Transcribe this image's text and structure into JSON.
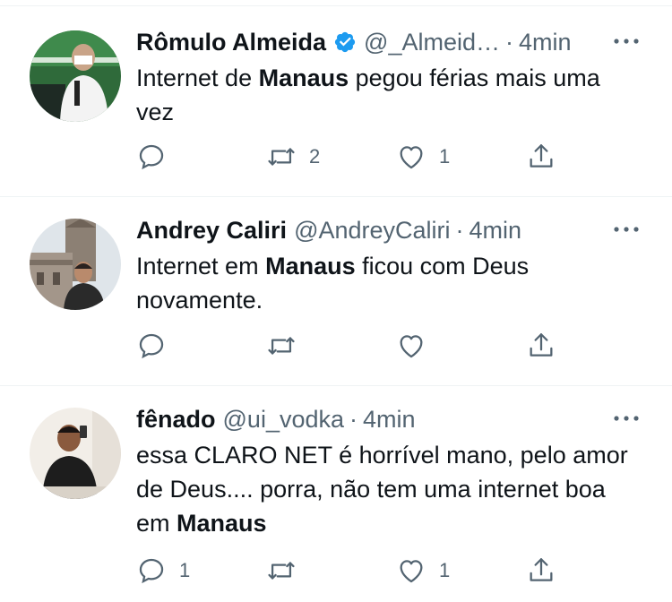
{
  "tweets": [
    {
      "name": "Rômulo Almeida",
      "verified": true,
      "handle": "@_Almeid…",
      "time": "4min",
      "text_before": "Internet de ",
      "text_bold": "Manaus",
      "text_after": " pegou férias mais uma vez",
      "replies": "",
      "retweets": "2",
      "likes": "1"
    },
    {
      "name": "Andrey Caliri",
      "verified": false,
      "handle": "@AndreyCaliri",
      "time": "4min",
      "text_before": "Internet em ",
      "text_bold": "Manaus",
      "text_after": " ficou com Deus novamente.",
      "replies": "",
      "retweets": "",
      "likes": ""
    },
    {
      "name": "fênado",
      "verified": false,
      "handle": "@ui_vodka",
      "time": "4min",
      "text_before": "essa CLARO NET é horrível mano, pelo amor de Deus.... porra, não tem uma internet boa em ",
      "text_bold": "Manaus",
      "text_after": "",
      "replies": "1",
      "retweets": "",
      "likes": "1"
    }
  ],
  "separator": "·",
  "icons": {
    "reply": "reply-icon",
    "retweet": "retweet-icon",
    "like": "heart-icon",
    "share": "share-icon",
    "more": "more-options-icon",
    "verified": "verified-badge-icon"
  },
  "colors": {
    "text": "#0f1419",
    "secondary": "#536471",
    "verified": "#1d9bf0",
    "divider": "#eff3f4"
  }
}
